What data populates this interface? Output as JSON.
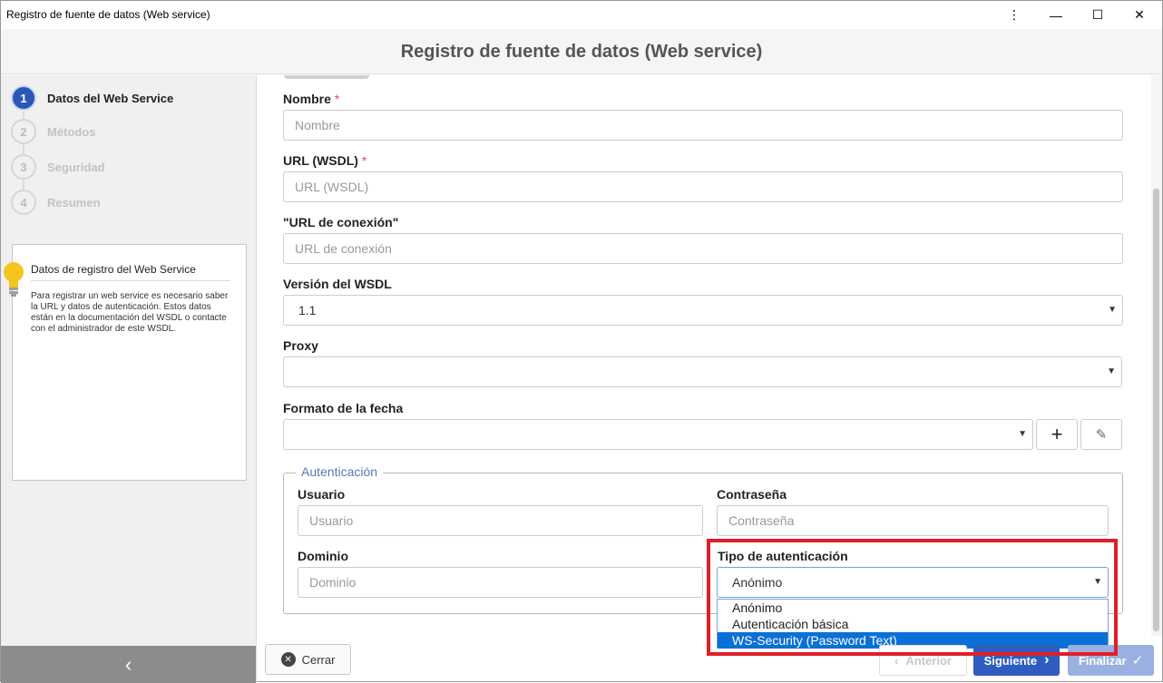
{
  "window": {
    "title": "Registro de fuente de datos (Web service)",
    "buttons": [
      "more-icon",
      "minimize-icon",
      "maximize-icon",
      "close-icon"
    ]
  },
  "header": {
    "title": "Registro de fuente de datos (Web service)"
  },
  "steps": [
    {
      "num": "1",
      "label": "Datos del Web Service",
      "active": true
    },
    {
      "num": "2",
      "label": "Métodos",
      "active": false
    },
    {
      "num": "3",
      "label": "Seguridad",
      "active": false
    },
    {
      "num": "4",
      "label": "Resumen",
      "active": false
    }
  ],
  "help": {
    "title": "Datos de registro del Web Service",
    "text": "Para registrar un web service es necesario saber la URL y datos de autenticación. Estos datos están en la documentación del WSDL o contacte con el administrador de este WSDL."
  },
  "form": {
    "nombre": {
      "label": "Nombre",
      "required": "*",
      "placeholder": "Nombre"
    },
    "url": {
      "label": "URL (WSDL)",
      "required": "*",
      "placeholder": "URL (WSDL)"
    },
    "url_conexion": {
      "label": "\"URL de conexión\"",
      "placeholder": "URL de conexión"
    },
    "version": {
      "label": "Versión del WSDL",
      "value": "1.1"
    },
    "proxy": {
      "label": "Proxy",
      "value": ""
    },
    "formato_fecha": {
      "label": "Formato de la fecha",
      "value": "",
      "add": "+",
      "edit": "✎"
    }
  },
  "auth": {
    "legend": "Autenticación",
    "usuario": {
      "label": "Usuario",
      "placeholder": "Usuario"
    },
    "contrasena": {
      "label": "Contraseña",
      "placeholder": "Contraseña"
    },
    "dominio": {
      "label": "Dominio",
      "placeholder": "Dominio"
    },
    "tipo": {
      "label": "Tipo de autenticación",
      "value": "Anónimo",
      "options": [
        "Anónimo",
        "Autenticación básica",
        "WS-Security (Password Text)"
      ],
      "highlighted": "WS-Security (Password Text)"
    }
  },
  "footer": {
    "close": "Cerrar",
    "prev": "Anterior",
    "next": "Siguiente",
    "finish": "Finalizar"
  },
  "colors": {
    "accent": "#2f5dbf",
    "highlight": "#e01e2a",
    "selection": "#0a6fd6"
  }
}
